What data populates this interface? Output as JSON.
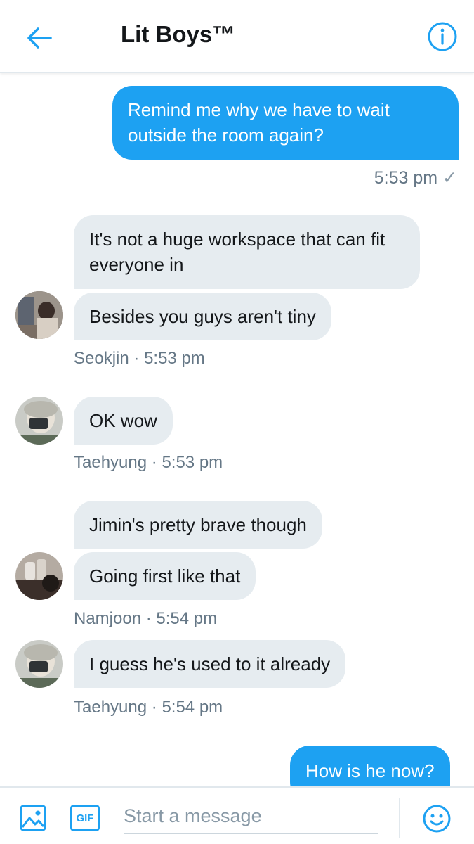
{
  "header": {
    "title": "Lit Boys™"
  },
  "colors": {
    "accent": "#1da1f2",
    "incoming_bubble": "#e6ecf0",
    "meta_text": "#657786"
  },
  "icons": {
    "back": "arrow-left-icon",
    "info": "info-icon",
    "image": "image-icon",
    "gif": "gif-icon",
    "emoji": "emoji-icon",
    "read": "checkmark-icon"
  },
  "messages": {
    "m1": {
      "text": "Remind me why we have to wait outside the room again?",
      "time": "5:53 pm",
      "status": "✓"
    },
    "m2": {
      "text": "It's not a huge workspace that can fit everyone in"
    },
    "m3": {
      "text": "Besides you guys aren't tiny"
    },
    "g1_meta": {
      "sender": "Seokjin",
      "sep": "·",
      "time": "5:53 pm"
    },
    "m4": {
      "text": "OK wow"
    },
    "g2_meta": {
      "sender": "Taehyung",
      "sep": "·",
      "time": "5:53 pm"
    },
    "m5": {
      "text": "Jimin's pretty brave though"
    },
    "m6": {
      "text": "Going first like that"
    },
    "g3_meta": {
      "sender": "Namjoon",
      "sep": "·",
      "time": "5:54 pm"
    },
    "m7": {
      "text": "I guess he's used to it already"
    },
    "g4_meta": {
      "sender": "Taehyung",
      "sep": "·",
      "time": "5:54 pm"
    },
    "m8": {
      "text": "How is he now?"
    }
  },
  "composer": {
    "placeholder": "Start a message",
    "gif_label": "GIF"
  }
}
